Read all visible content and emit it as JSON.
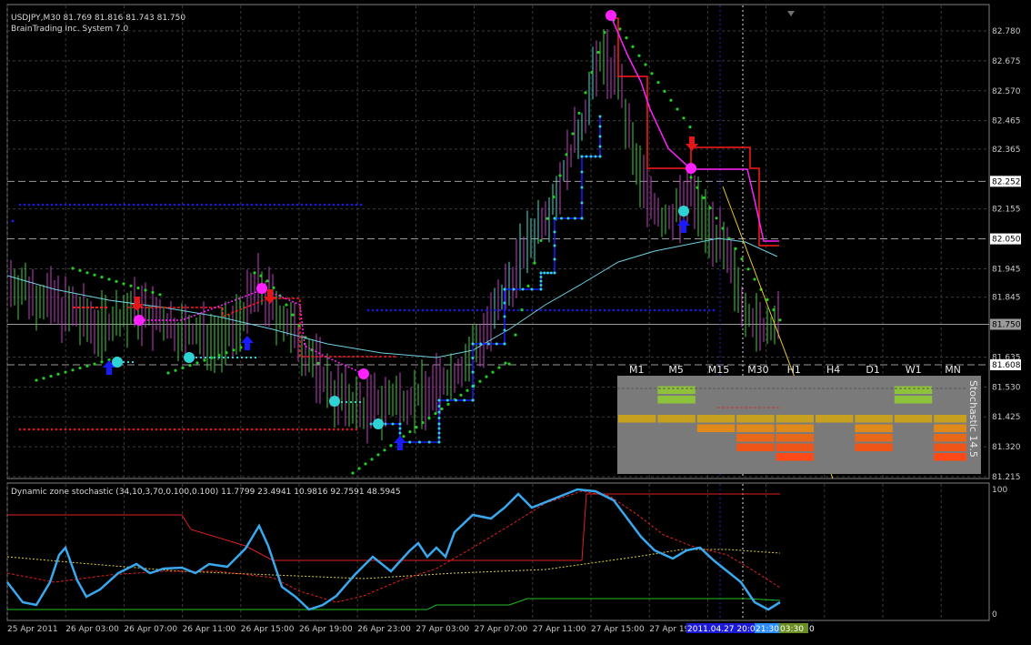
{
  "chart": {
    "symbol_header": "USDJPY,M30  81.769 81.816 81.743 81.750",
    "system_label": "BrainTrading Inc. System 7.0",
    "price_axis": [
      "82.780",
      "82.675",
      "82.570",
      "82.465",
      "82.365",
      "82.252",
      "82.155",
      "82.050",
      "81.945",
      "81.845",
      "81.750",
      "81.635",
      "81.608",
      "81.530",
      "81.425",
      "81.320",
      "81.215"
    ],
    "highlighted_prices": [
      "82.252",
      "82.050",
      "81.750",
      "81.608"
    ],
    "time_axis": [
      "25 Apr 2011",
      "26 Apr 03:00",
      "26 Apr 07:00",
      "26 Apr 11:00",
      "26 Apr 15:00",
      "26 Apr 19:00",
      "26 Apr 23:00",
      "27 Apr 03:00",
      "27 Apr 07:00",
      "27 Apr 11:00",
      "27 Apr 15:00",
      "27 Apr 19"
    ],
    "time_highlights": [
      "2011.04.27 20:00",
      "21:30",
      "03:30",
      "0"
    ],
    "colors": {
      "grid": "#3a3a3a",
      "bull": "#3cd23c",
      "bear": "#c83cc8",
      "up_arrow": "#1a1aff",
      "down_arrow": "#e01818",
      "cyan": "#2fd3d3",
      "magenta": "#ff22ff",
      "red_line": "#ff1a1a"
    }
  },
  "mtf_panel": {
    "timeframes": [
      "M1",
      "M5",
      "M15",
      "M30",
      "H1",
      "H4",
      "D1",
      "W1",
      "MN"
    ],
    "vertical_title": "Stochastic 14.5"
  },
  "oscillator": {
    "label": "Dynamic zone stochastic (34,10,3,70,0.100,0.100) 11.7799 23.4941 10.9816 92.7591 48.5945",
    "axis_top": "100",
    "axis_bottom": "0"
  }
}
